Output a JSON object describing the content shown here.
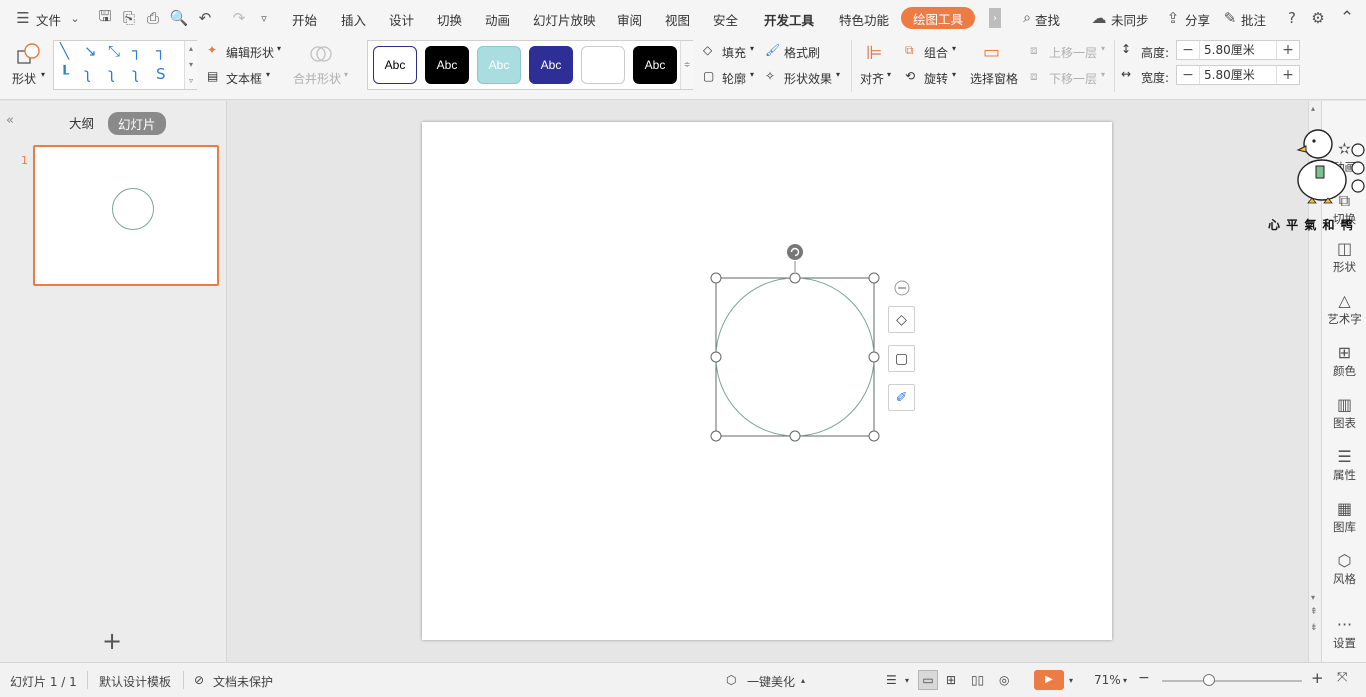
{
  "menu": {
    "file": "文件",
    "tabs": [
      "开始",
      "插入",
      "设计",
      "切换",
      "动画",
      "幻灯片放映",
      "审阅",
      "视图",
      "安全",
      "开发工具",
      "特色功能"
    ],
    "active_tab": "绘图工具",
    "search": "查找",
    "sync": "未同步",
    "share": "分享",
    "comment": "批注"
  },
  "ribbon": {
    "shape_label": "形状",
    "edit_shape": "编辑形状",
    "text_box": "文本框",
    "merge_shape": "合并形状",
    "style_swatches": [
      {
        "text": "Abc",
        "bg": "#ffffff",
        "fg": "#000000",
        "border": "#2e2f86"
      },
      {
        "text": "Abc",
        "bg": "#000000",
        "fg": "#ffffff",
        "border": "#000000"
      },
      {
        "text": "Abc",
        "bg": "#a9dde0",
        "fg": "#ffffff",
        "border": "#8fc7cb"
      },
      {
        "text": "Abc",
        "bg": "#2e2f96",
        "fg": "#ffffff",
        "border": "#2e2f96"
      },
      {
        "text": "",
        "bg": "#ffffff",
        "fg": "#000000",
        "border": "#cccccc"
      },
      {
        "text": "Abc",
        "bg": "#000000",
        "fg": "#ffffff",
        "border": "#000000"
      }
    ],
    "fill": "填充",
    "format_painter": "格式刷",
    "outline": "轮廓",
    "shape_effect": "形状效果",
    "align": "对齐",
    "group": "组合",
    "rotate": "旋转",
    "selection_pane": "选择窗格",
    "bring_forward": "上移一层",
    "send_backward": "下移一层",
    "height_label": "高度:",
    "height_value": "5.80厘米",
    "width_label": "宽度:",
    "width_value": "5.80厘米"
  },
  "left_panel": {
    "tab_outline": "大纲",
    "tab_slides": "幻灯片",
    "slide_number": "1",
    "add": "+"
  },
  "right_panel": {
    "items": [
      "动画",
      "切换",
      "形状",
      "艺术字",
      "颜色",
      "图表",
      "属性",
      "图库",
      "风格",
      "设置"
    ]
  },
  "watermark": {
    "text": "心 平 氣 和 鸭"
  },
  "statusbar": {
    "slide_count": "幻灯片 1 / 1",
    "template": "默认设计模板",
    "protect": "文档未保护",
    "beautify": "一键美化",
    "zoom": "71%"
  },
  "colors": {
    "accent": "#ec7c44",
    "circle_stroke": "#7fa39b",
    "gallery_icon": "#2f7bd7"
  }
}
